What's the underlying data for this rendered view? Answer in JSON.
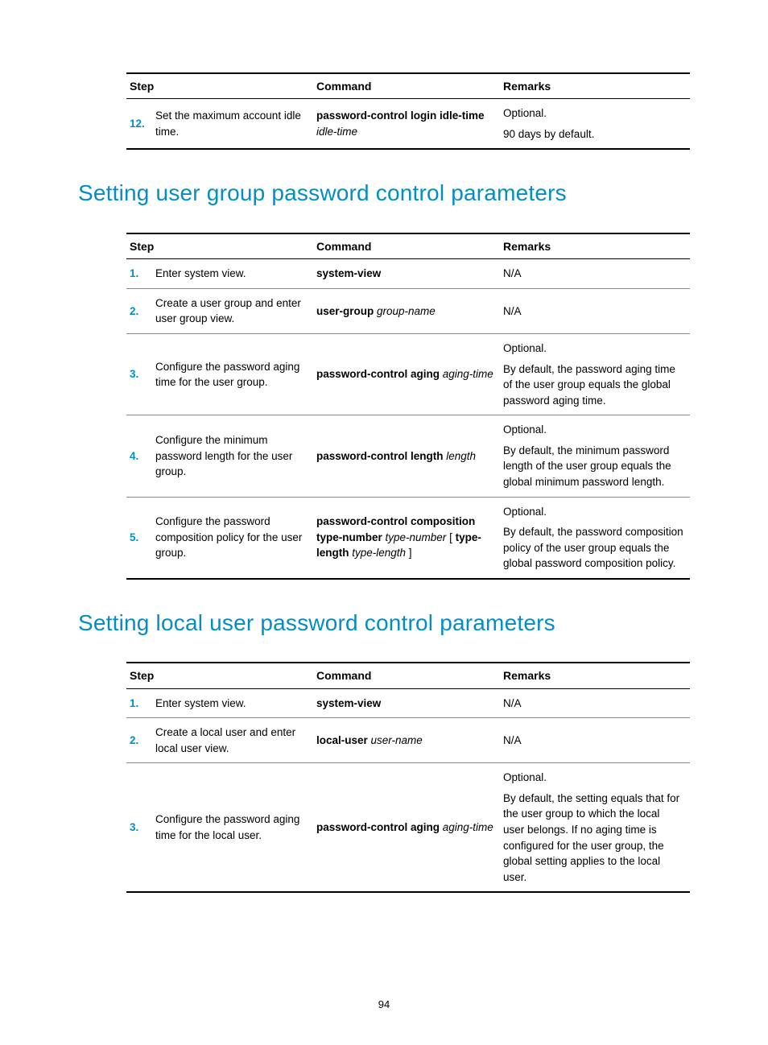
{
  "firstTable": {
    "headers": {
      "step": "Step",
      "command": "Command",
      "remarks": "Remarks"
    },
    "rows": [
      {
        "num": "12.",
        "step": "Set the maximum account idle time.",
        "cmd": [
          {
            "t": "password-control login idle-time ",
            "s": "bold"
          },
          {
            "t": "idle-time",
            "s": "italic"
          }
        ],
        "remarks": "Optional.\n90 days by default."
      }
    ]
  },
  "heading1": "Setting user group password control parameters",
  "table1": {
    "headers": {
      "step": "Step",
      "command": "Command",
      "remarks": "Remarks"
    },
    "rows": [
      {
        "num": "1.",
        "step": "Enter system view.",
        "cmd": [
          {
            "t": "system-view",
            "s": "bold"
          }
        ],
        "remarks": "N/A"
      },
      {
        "num": "2.",
        "step": "Create a user group and enter user group view.",
        "cmd": [
          {
            "t": "user-group ",
            "s": "bold"
          },
          {
            "t": "group-name",
            "s": "italic"
          }
        ],
        "remarks": "N/A"
      },
      {
        "num": "3.",
        "step": "Configure the password aging time for the user group.",
        "cmd": [
          {
            "t": "password-control aging ",
            "s": "bold"
          },
          {
            "t": "aging-time",
            "s": "italic"
          }
        ],
        "remarks": "Optional.\nBy default, the password aging time of the user group equals the global password aging time."
      },
      {
        "num": "4.",
        "step": "Configure the minimum password length for the user group.",
        "cmd": [
          {
            "t": "password-control length ",
            "s": "bold"
          },
          {
            "t": "length",
            "s": "italic"
          }
        ],
        "remarks": "Optional.\nBy default, the minimum password length of the user group equals the global minimum password length."
      },
      {
        "num": "5.",
        "step": "Configure the password composition policy for the user group.",
        "cmd": [
          {
            "t": "password-control composition type-number ",
            "s": "bold"
          },
          {
            "t": "type-number",
            "s": "italic"
          },
          {
            "t": " [ ",
            "s": ""
          },
          {
            "t": "type-length ",
            "s": "bold"
          },
          {
            "t": "type-length",
            "s": "italic"
          },
          {
            "t": " ]",
            "s": ""
          }
        ],
        "remarks": "Optional.\nBy default, the password composition policy of the user group equals the global password composition policy."
      }
    ]
  },
  "heading2": "Setting local user password control parameters",
  "table2": {
    "headers": {
      "step": "Step",
      "command": "Command",
      "remarks": "Remarks"
    },
    "rows": [
      {
        "num": "1.",
        "step": "Enter system view.",
        "cmd": [
          {
            "t": "system-view",
            "s": "bold"
          }
        ],
        "remarks": "N/A"
      },
      {
        "num": "2.",
        "step": "Create a local user and enter local user view.",
        "cmd": [
          {
            "t": "local-user ",
            "s": "bold"
          },
          {
            "t": "user-name",
            "s": "italic"
          }
        ],
        "remarks": "N/A"
      },
      {
        "num": "3.",
        "step": "Configure the password aging time for the local user.",
        "cmd": [
          {
            "t": "password-control aging ",
            "s": "bold"
          },
          {
            "t": "aging-time",
            "s": "italic"
          }
        ],
        "remarks": "Optional.\nBy default, the setting equals that for the user group to which the local user belongs. If no aging time is configured for the user group, the global setting applies to the local user."
      }
    ]
  },
  "pageNumber": "94"
}
